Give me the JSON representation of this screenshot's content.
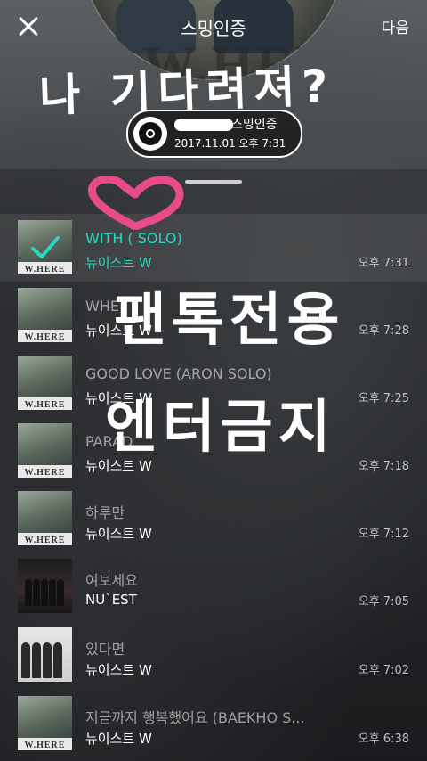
{
  "header": {
    "title": "스밍인증",
    "next_label": "다음",
    "handwritten_top": "나 기다려져?",
    "badge": {
      "label": "스밍인증",
      "date": "2017.11.01 오후 7:31"
    }
  },
  "overlay": {
    "line1": "팬톡전용",
    "line2": "엔터금지"
  },
  "colors": {
    "accent": "#27d8c2",
    "heart": "#e84a8a"
  },
  "tracks": [
    {
      "title": "WITH (   SOLO)",
      "artist": "뉴이스트 W",
      "time": "오후 7:31",
      "selected": true,
      "thumb": "where"
    },
    {
      "title": "WHE",
      "artist": "뉴이스트 W",
      "time": "오후 7:28",
      "selected": false,
      "thumb": "where"
    },
    {
      "title": "GOOD LOVE (ARON SOLO)",
      "artist": "뉴이스트 W",
      "time": "오후 7:25",
      "selected": false,
      "thumb": "where"
    },
    {
      "title": "PARAD",
      "artist": "뉴이스트 W",
      "time": "오후 7:18",
      "selected": false,
      "thumb": "where"
    },
    {
      "title": "하루만",
      "artist": "뉴이스트 W",
      "time": "오후 7:12",
      "selected": false,
      "thumb": "where"
    },
    {
      "title": "여보세요",
      "artist": "NU`EST",
      "time": "오후 7:05",
      "selected": false,
      "thumb": "dark"
    },
    {
      "title": "있다면",
      "artist": "뉴이스트 W",
      "time": "오후 7:02",
      "selected": false,
      "thumb": "light"
    },
    {
      "title": "지금까지 행복했어요 (BAEKHO S...",
      "artist": "뉴이스트 W",
      "time": "오후 6:38",
      "selected": false,
      "thumb": "where"
    }
  ],
  "thumb_text": "W.HERE"
}
